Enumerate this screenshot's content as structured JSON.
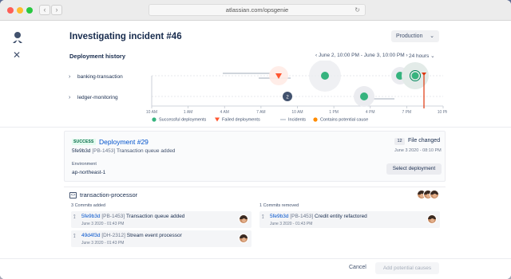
{
  "browser": {
    "url": "atlassian.com/opsgenie",
    "back_glyph": "‹",
    "forward_glyph": "›",
    "reload_glyph": "↻",
    "traffic_lights": [
      "#fe5f57",
      "#febc2e",
      "#28c840"
    ]
  },
  "sidebar": {
    "avatar_icon": "opsgenie-user-icon",
    "close_icon": "close-icon",
    "close_glyph": "✕"
  },
  "header": {
    "title": "Investigating incident #46",
    "environment": "Production",
    "env_chevron": "⌄"
  },
  "deployment_history": {
    "title": "Deployment history",
    "range_label": "‹  June 2, 10:00 PM - June 3, 10:00 PM  ›",
    "duration_label": "24 hours ⌄",
    "rows": [
      {
        "label": "banking-transaction",
        "chevron": "›"
      },
      {
        "label": "ledger-monitoring",
        "chevron": "›"
      }
    ],
    "ticks": [
      "10 AM",
      "1 AM",
      "4 AM",
      "7 AM",
      "10 AM",
      "1 PM",
      "4 PM",
      "7 PM",
      "10 PM"
    ],
    "cluster_count": "2",
    "legend": [
      {
        "label": "Successful deployments",
        "color": "#36b37e",
        "icon": "green-dot-icon"
      },
      {
        "label": "Failed deployments",
        "color": "#ff5630",
        "icon": "red-triangle-icon"
      },
      {
        "label": "Incidents",
        "color": "#c1c7d0",
        "icon": "incident-line-icon"
      },
      {
        "label": "Contains potential cause",
        "color": "#ff8b00",
        "icon": "orange-dot-icon"
      }
    ]
  },
  "deployment": {
    "status": "SUCCESS",
    "title": "Deployment #29",
    "commit_hash": "5fe9b3d",
    "commit_ticket": "[PB-1453]",
    "commit_message": "Transaction queue added",
    "env_label": "Environment",
    "env_value": "ap-northeast-1",
    "files_changed_count": "12",
    "files_changed_label": "File changed",
    "date": "June 3 2020 - 08:10 PM",
    "select_button": "Select deployment"
  },
  "repository": {
    "name": "transaction-processor",
    "icon": "code-icon",
    "icon_glyph": "<>",
    "added_title": "3 Commits added",
    "removed_title": "1 Commits removed",
    "added": [
      {
        "hash": "5fe9b3d",
        "ticket": "[PB-1453]",
        "message": "Transaction queue added",
        "date": "June 3 2020 - 01:43 PM"
      },
      {
        "hash": "49d4f3d",
        "ticket": "[DH-2312]",
        "message": "Stream event processor",
        "date": "June 3 2020 - 01:43 PM"
      }
    ],
    "removed": [
      {
        "hash": "5fe9b3d",
        "ticket": "[PB-1453]",
        "message": "Credit entity refactored",
        "date": "June 3 2020 - 01:43 PM"
      }
    ],
    "commit_glyph": "⟟"
  },
  "footer": {
    "cancel": "Cancel",
    "add_causes": "Add potential causes"
  }
}
